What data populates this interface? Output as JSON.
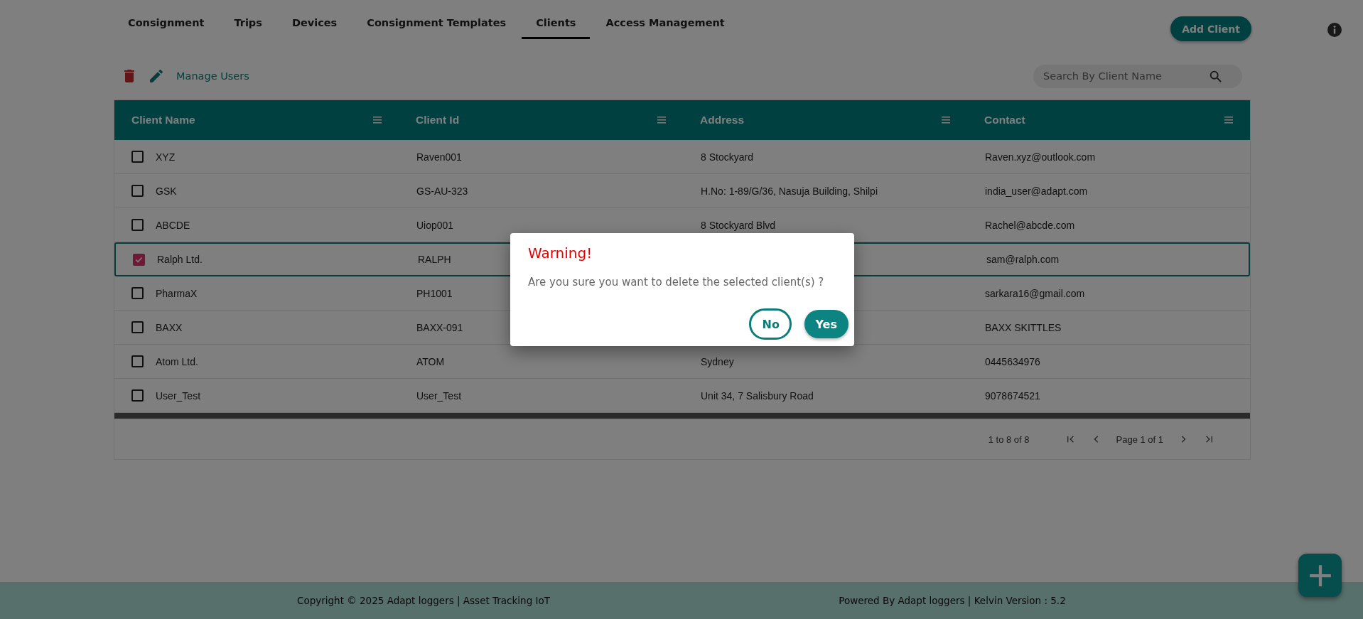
{
  "tabs": [
    {
      "label": "Consignment",
      "selected": false
    },
    {
      "label": "Trips",
      "selected": false
    },
    {
      "label": "Devices",
      "selected": false
    },
    {
      "label": "Consignment Templates",
      "selected": false
    },
    {
      "label": "Clients",
      "selected": true
    },
    {
      "label": "Access Management",
      "selected": false
    }
  ],
  "add_button": "Add Client",
  "toolbar": {
    "manage_users": "Manage Users"
  },
  "search": {
    "placeholder": "Search By Client Name"
  },
  "table": {
    "columns": [
      "Client Name",
      "Client Id",
      "Address",
      "Contact"
    ],
    "rows": [
      {
        "checked": false,
        "name": "XYZ",
        "id": "Raven001",
        "address": "8 Stockyard",
        "contact": "Raven.xyz@outlook.com"
      },
      {
        "checked": false,
        "name": "GSK",
        "id": "GS-AU-323",
        "address": "H.No: 1-89/G/36, Nasuja Building, Shilpi",
        "contact": "india_user@adapt.com"
      },
      {
        "checked": false,
        "name": "ABCDE",
        "id": "Uiop001",
        "address": "8 Stockyard Blvd",
        "contact": "Rachel@abcde.com"
      },
      {
        "checked": true,
        "name": "Ralph Ltd.",
        "id": "RALPH",
        "contact": "sam@ralph.com"
      },
      {
        "checked": false,
        "name": "PharmaX",
        "id": "PH1001",
        "contact": "sarkara16@gmail.com"
      },
      {
        "checked": false,
        "name": "BAXX",
        "id": "BAXX-091",
        "contact": "BAXX SKITTLES"
      },
      {
        "checked": false,
        "name": "Atom Ltd.",
        "id": "ATOM",
        "address": "Sydney",
        "contact": "0445634976"
      },
      {
        "checked": false,
        "name": "User_Test",
        "id": "User_Test",
        "address": "Unit 34, 7 Salisbury Road",
        "contact": "9078674521"
      }
    ]
  },
  "pagination": {
    "range": "1 to 8 of 8",
    "page": "Page 1 of 1"
  },
  "dialog": {
    "title": "Warning!",
    "message": "Are you sure you want to delete the selected client(s) ?",
    "buttons": [
      {
        "label": "No",
        "kind": "outline"
      },
      {
        "label": "Yes",
        "kind": "filled"
      }
    ]
  },
  "footer": {
    "left": "Copyright © 2025 Adapt loggers | Asset Tracking IoT",
    "right": "Powered By Adapt loggers | Kelvin Version : 5.2"
  }
}
